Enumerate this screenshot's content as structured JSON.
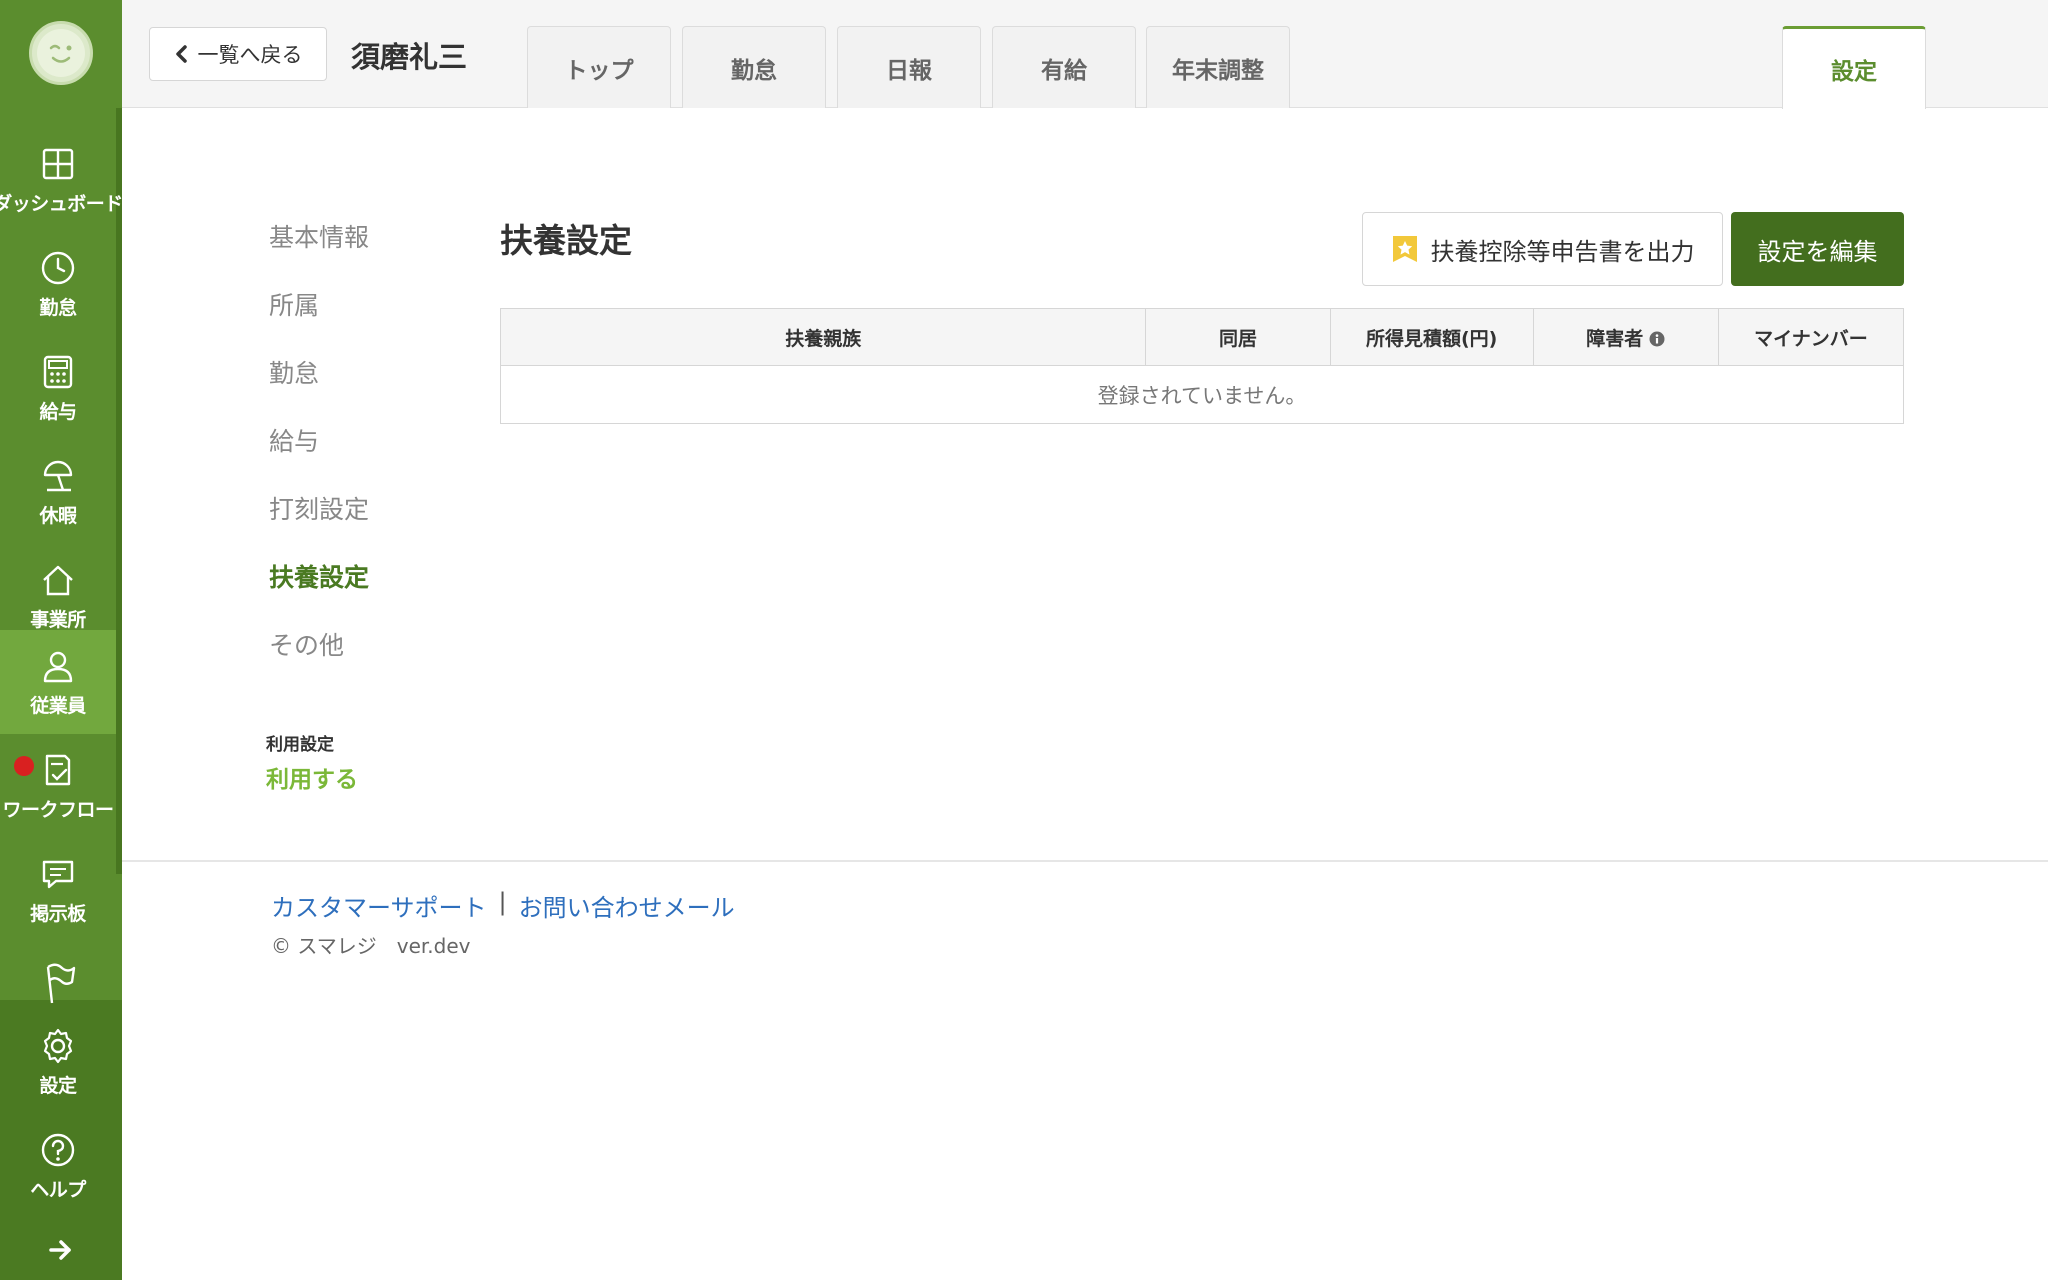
{
  "rail": {
    "items": [
      {
        "label": "ダッシュボード",
        "icon": "dashboard-icon"
      },
      {
        "label": "勤怠",
        "icon": "clock-icon"
      },
      {
        "label": "給与",
        "icon": "calculator-icon"
      },
      {
        "label": "休暇",
        "icon": "umbrella-icon"
      },
      {
        "label": "事業所",
        "icon": "home-icon"
      },
      {
        "label": "従業員",
        "icon": "person-icon"
      },
      {
        "label": "ワークフロー",
        "icon": "workflow-icon"
      },
      {
        "label": "掲示板",
        "icon": "chat-icon"
      }
    ],
    "bottom": [
      {
        "label": "設定",
        "icon": "gear-icon"
      },
      {
        "label": "ヘルプ",
        "icon": "help-icon"
      }
    ],
    "active_index": 5,
    "accent": "#5b8d2e"
  },
  "header": {
    "back_label": "一覧へ戻る",
    "employee_name": "須磨礼三",
    "tabs": [
      "トップ",
      "勤怠",
      "日報",
      "有給",
      "年末調整"
    ],
    "settings_tab": "設定"
  },
  "subnav": {
    "items": [
      "基本情報",
      "所属",
      "勤怠",
      "給与",
      "打刻設定",
      "扶養設定",
      "その他"
    ],
    "active_index": 5,
    "usage_label": "利用設定",
    "usage_value": "利用する"
  },
  "main": {
    "title": "扶養設定",
    "output_button": "扶養控除等申告書を出力",
    "edit_button": "設定を編集",
    "table": {
      "columns": [
        "扶養親族",
        "同居",
        "所得見積額(円)",
        "障害者",
        "マイナンバー"
      ],
      "empty_message": "登録されていません。"
    }
  },
  "footer": {
    "support_link": "カスタマーサポート",
    "separator": "|",
    "mail_link": "お問い合わせメール",
    "copyright": "© スマレジ　ver.dev"
  }
}
